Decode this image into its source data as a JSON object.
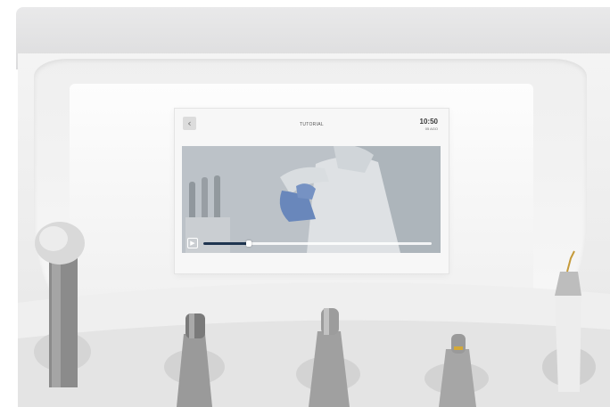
{
  "screen": {
    "back_icon": "chevron-left-icon",
    "title": "TUTORIAL",
    "clock_time": "10:50",
    "clock_sub": "05 AGO"
  },
  "video": {
    "play_icon": "play-icon",
    "progress": 0.2
  },
  "colors": {
    "progress_fill": "#1f3550",
    "glove_blue": "#6f8fc6"
  }
}
